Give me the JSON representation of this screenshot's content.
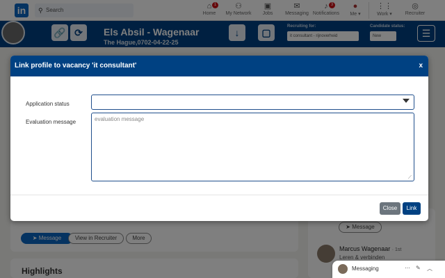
{
  "topnav": {
    "logo": "in",
    "search_placeholder": "Search",
    "items": [
      {
        "label": "Home",
        "icon": "home-icon",
        "glyph": "⌂",
        "badge": "1"
      },
      {
        "label": "My Network",
        "icon": "network-icon",
        "glyph": "⚇",
        "badge": ""
      },
      {
        "label": "Jobs",
        "icon": "briefcase-icon",
        "glyph": "▣",
        "badge": ""
      },
      {
        "label": "Messaging",
        "icon": "chat-icon",
        "glyph": "✉",
        "badge": ""
      },
      {
        "label": "Notifications",
        "icon": "bell-icon",
        "glyph": "♪",
        "badge": "3"
      },
      {
        "label": "Me ▾",
        "icon": "avatar-icon",
        "glyph": "●",
        "badge": ""
      },
      {
        "label": "Work ▾",
        "icon": "grid-icon",
        "glyph": "⋮⋮",
        "badge": ""
      },
      {
        "label": "Recruiter",
        "icon": "recruiter-icon",
        "glyph": "◎",
        "badge": ""
      }
    ]
  },
  "recruiter_bar": {
    "candidate_name": "Els Absil - Wagenaar",
    "candidate_sub": "The Hague,0702-04-22-25",
    "recruiting_for_label": "Recruiting for:",
    "recruiting_for_value": "it consultant - rijnoverheid",
    "candidate_status_label": "Candidate status:",
    "candidate_status_value": "New"
  },
  "background": {
    "message_btn": "Message",
    "view_recruiter_btn": "View in Recruiter",
    "more_btn": "More",
    "highlights": "Highlights",
    "side_message_btn": "Message",
    "person_name": "Marcus Wagenaar",
    "person_degree": "· 1st",
    "person_title": "Leren & verbinden"
  },
  "messaging": {
    "label": "Messaging"
  },
  "modal": {
    "title": "Link profile to vacancy 'it consultant'",
    "close_x": "x",
    "application_status_label": "Application status",
    "application_status_value": "",
    "evaluation_label": "Evaluation message",
    "evaluation_placeholder": "evaluation message",
    "evaluation_value": "",
    "close_button": "Close",
    "link_button": "Link"
  },
  "colors": {
    "brand_blue": "#004182",
    "linkedin_blue": "#0a66c2",
    "close_gray": "#6c757d"
  }
}
